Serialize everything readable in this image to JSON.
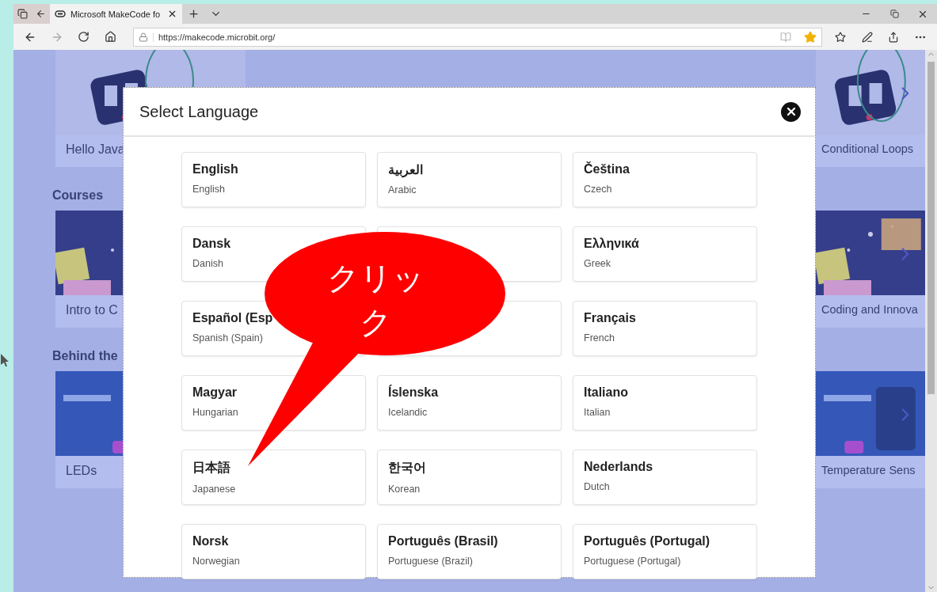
{
  "browser": {
    "tab_title": "Microsoft MakeCode fo",
    "url": "https://makecode.microbit.org/",
    "favorite": true
  },
  "page": {
    "rows": [
      {
        "left_title": "Hello Java",
        "right_title": "Conditional Loops"
      },
      {
        "heading": "Courses",
        "left_title": "Intro to C",
        "right_title": "Coding and Innova"
      },
      {
        "heading": "Behind the",
        "left_title": "LEDs",
        "right_title": "Temperature Sens"
      }
    ]
  },
  "dialog": {
    "title": "Select Language",
    "languages": [
      {
        "kind": "language",
        "name": "English",
        "english": "English"
      },
      {
        "kind": "language",
        "name": "العربية",
        "english": "Arabic"
      },
      {
        "kind": "language",
        "name": "Čeština",
        "english": "Czech"
      },
      {
        "kind": "language",
        "name": "Dansk",
        "english": "Danish"
      },
      {
        "kind": "covered"
      },
      {
        "kind": "language",
        "name": "Ελληνικά",
        "english": "Greek"
      },
      {
        "kind": "language",
        "name": "Español (Esp",
        "english": "Spanish (Spain)"
      },
      {
        "kind": "covered"
      },
      {
        "kind": "language",
        "name": "Français",
        "english": "French"
      },
      {
        "kind": "language",
        "name": "Magyar",
        "english": "Hungarian"
      },
      {
        "kind": "language",
        "name": "Íslenska",
        "english": "Icelandic"
      },
      {
        "kind": "language",
        "name": "Italiano",
        "english": "Italian"
      },
      {
        "kind": "language",
        "name": "日本語",
        "english": "Japanese"
      },
      {
        "kind": "language",
        "name": "한국어",
        "english": "Korean"
      },
      {
        "kind": "language",
        "name": "Nederlands",
        "english": "Dutch"
      },
      {
        "kind": "language",
        "name": "Norsk",
        "english": "Norwegian"
      },
      {
        "kind": "language",
        "name": "Português (Brasil)",
        "english": "Portuguese (Brazil)"
      },
      {
        "kind": "language",
        "name": "Português (Portugal)",
        "english": "Portuguese (Portugal)"
      }
    ]
  },
  "callout": {
    "text": "クリック"
  }
}
